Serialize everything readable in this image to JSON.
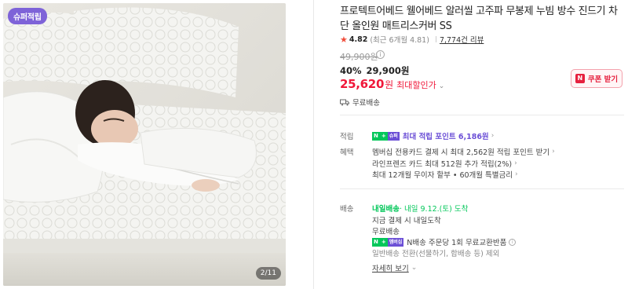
{
  "gallery": {
    "badge": "슈퍼적립",
    "counter": "2/11"
  },
  "product": {
    "title": "프로텍트어베드 웰어베드 알러씰 고주파 무봉제 누빔 방수 진드기 차단 올인원 매트리스커버 SS",
    "rating_score": "4.82",
    "rating_recent": "(최근 6개월 4.81)",
    "review_count": "7,774건 리뷰",
    "original_price": "49,900원",
    "discount_rate": "40%",
    "sale_price": "29,900원",
    "max_discount_price": "25,620",
    "max_discount_unit": "원",
    "max_discount_label": "최대할인가",
    "coupon_label": "쿠폰 받기",
    "shipping_top": "무료배송"
  },
  "accumulate": {
    "label": "적립",
    "badge_n": "N",
    "badge_plus": "슈퍼",
    "text": "최대 적립 포인트 6,186원"
  },
  "benefit": {
    "label": "혜택",
    "items": [
      "멤버십 전용카드 결제 시 최대 2,562원 적립 포인트 받기",
      "라인프렌즈 카드 최대 512원 추가 적립(2%)",
      "최대 12개월 무이자 할부 • 60개월 특별금리"
    ]
  },
  "delivery": {
    "label": "배송",
    "badge": "내일배송",
    "arrival": " · 내일 9.12.(토) 도착",
    "line1": "지금 결제 시 내일도착",
    "line2": "무료배송",
    "return_badge_n": "N",
    "return_badge_plus": "멤버십",
    "return_text": "N배송 주문당 1회 무료교환반품",
    "note": "일반배송 전환(선물하기, 합배송 등) 제외",
    "more": "자세히 보기"
  },
  "colors": {
    "accent_red": "#f0183a",
    "npay_green": "#03c75a",
    "super_purple": "#6b4fd6"
  }
}
